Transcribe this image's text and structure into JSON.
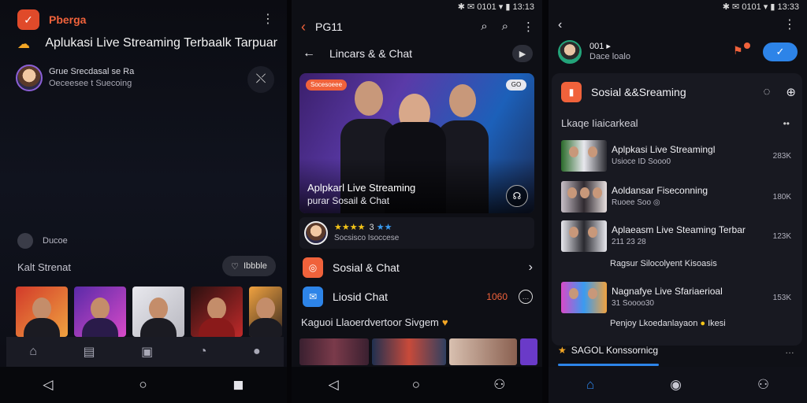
{
  "colors": {
    "accent": "#f0623b",
    "blue": "#2d84e8",
    "gold": "#f5c518",
    "background": "#0a0b10"
  },
  "panel1": {
    "app_name": "Pberga",
    "headline": "Aplukasi Live Streaming Terbaalk Tarpuar",
    "user": {
      "line1": "Grue Srecdasal se Ra",
      "line2": "Oeceesee t Suecoing"
    },
    "dot_label": "Ducoe",
    "section_title": "Kalt Strenat",
    "chip_label": "Ibbble",
    "nav_icons": [
      "home-icon",
      "feed-icon",
      "book-icon",
      "music-icon",
      "profile-icon"
    ]
  },
  "panel2": {
    "statusbar": "✱ ✉ 0101 ▾ ▮ 13:13",
    "title": "PG11",
    "subtitle": "Lincars & & Chat",
    "hero": {
      "badge": "Socesoeee",
      "tag": "GO",
      "title": "Aplpkarl Live Streaming",
      "subtitle": "purar Sosail & Chat"
    },
    "rating": {
      "stars": "★★★★",
      "count": "3",
      "extra_stars": "★★",
      "subtitle": "Socsisco Isoccese"
    },
    "rows": [
      {
        "label": "Sosial & Chat"
      },
      {
        "label": "Liosid Chat",
        "count": "1060"
      }
    ],
    "caption": "Kaguoi Llaoerdvertoor Sivgem"
  },
  "panel3": {
    "statusbar": "✱ ✉ 0101 ▾ ▮ 13:33",
    "profile": {
      "name": "001 ▸",
      "sub": "Dace loalo"
    },
    "card_title": "Sosial &&Sreaming",
    "section_title": "Lkaqe Iiaicarkeal",
    "feed": [
      {
        "title": "Aplpkasi Live Streamingl",
        "meta": "Usioce ID Sooo0",
        "count": "283K"
      },
      {
        "title": "Aoldansar Fiseconning",
        "meta": "Ruoee Soo ◎",
        "count": "180K"
      },
      {
        "title": "Aplaeasm Live Steaming Terbar",
        "meta": "211 23 28",
        "count": "123K"
      },
      {
        "title": "Nagnafye Live Sfariaerioal",
        "meta": "31 Soooo30",
        "count": "153K"
      }
    ],
    "notes": [
      "Ragsur Silocolyent Kisoasis",
      "Penjoy Lkoedanlayaon",
      "Ikesi"
    ],
    "bottom_title": "SAGOL Konssornicg",
    "progress": 0.4
  }
}
